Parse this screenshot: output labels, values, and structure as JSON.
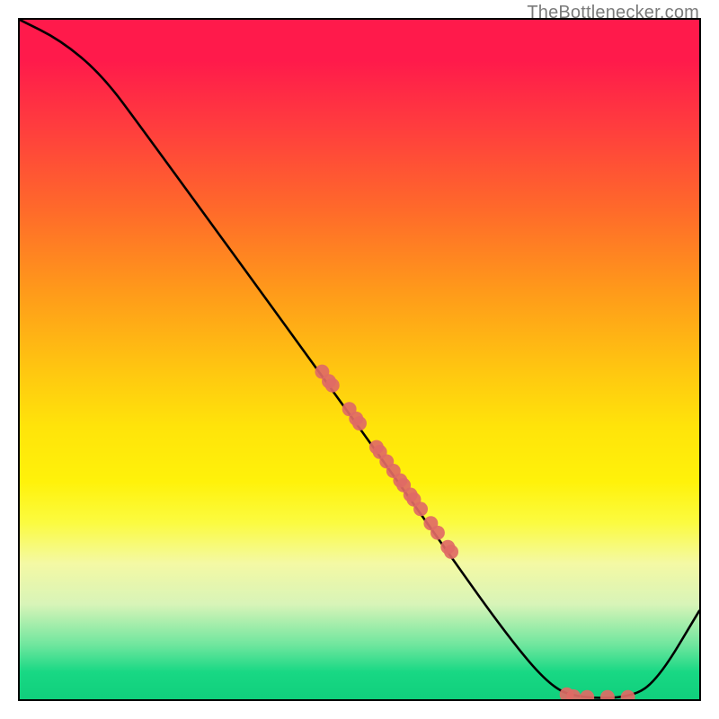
{
  "watermark": "TheBottlenecker.com",
  "chart_data": {
    "type": "line",
    "title": "",
    "xlabel": "",
    "ylabel": "",
    "xlim": [
      0,
      100
    ],
    "ylim": [
      0,
      100
    ],
    "grid": false,
    "legend": false,
    "curve": [
      {
        "x": 0,
        "y": 100
      },
      {
        "x": 6,
        "y": 97
      },
      {
        "x": 12,
        "y": 92
      },
      {
        "x": 18,
        "y": 84
      },
      {
        "x": 50,
        "y": 40
      },
      {
        "x": 62,
        "y": 23
      },
      {
        "x": 72,
        "y": 9
      },
      {
        "x": 78,
        "y": 2
      },
      {
        "x": 82,
        "y": 0.2
      },
      {
        "x": 90,
        "y": 0.2
      },
      {
        "x": 94,
        "y": 3
      },
      {
        "x": 100,
        "y": 13
      }
    ],
    "scatter": [
      {
        "x": 44.5,
        "y": 48.2
      },
      {
        "x": 45.5,
        "y": 46.8
      },
      {
        "x": 46.0,
        "y": 46.2
      },
      {
        "x": 48.5,
        "y": 42.7
      },
      {
        "x": 49.5,
        "y": 41.3
      },
      {
        "x": 50.0,
        "y": 40.6
      },
      {
        "x": 52.5,
        "y": 37.1
      },
      {
        "x": 53.0,
        "y": 36.4
      },
      {
        "x": 54.0,
        "y": 35.0
      },
      {
        "x": 55.0,
        "y": 33.6
      },
      {
        "x": 56.0,
        "y": 32.2
      },
      {
        "x": 56.5,
        "y": 31.5
      },
      {
        "x": 57.5,
        "y": 30.1
      },
      {
        "x": 58.0,
        "y": 29.4
      },
      {
        "x": 59.0,
        "y": 28.0
      },
      {
        "x": 60.5,
        "y": 25.9
      },
      {
        "x": 61.5,
        "y": 24.5
      },
      {
        "x": 63.0,
        "y": 22.4
      },
      {
        "x": 63.5,
        "y": 21.7
      },
      {
        "x": 80.5,
        "y": 0.7
      },
      {
        "x": 81.5,
        "y": 0.4
      },
      {
        "x": 83.5,
        "y": 0.3
      },
      {
        "x": 86.5,
        "y": 0.3
      },
      {
        "x": 89.5,
        "y": 0.3
      }
    ],
    "curve_color": "#000000",
    "scatter_color": "#e06a65",
    "scatter_radius_px": 8
  }
}
